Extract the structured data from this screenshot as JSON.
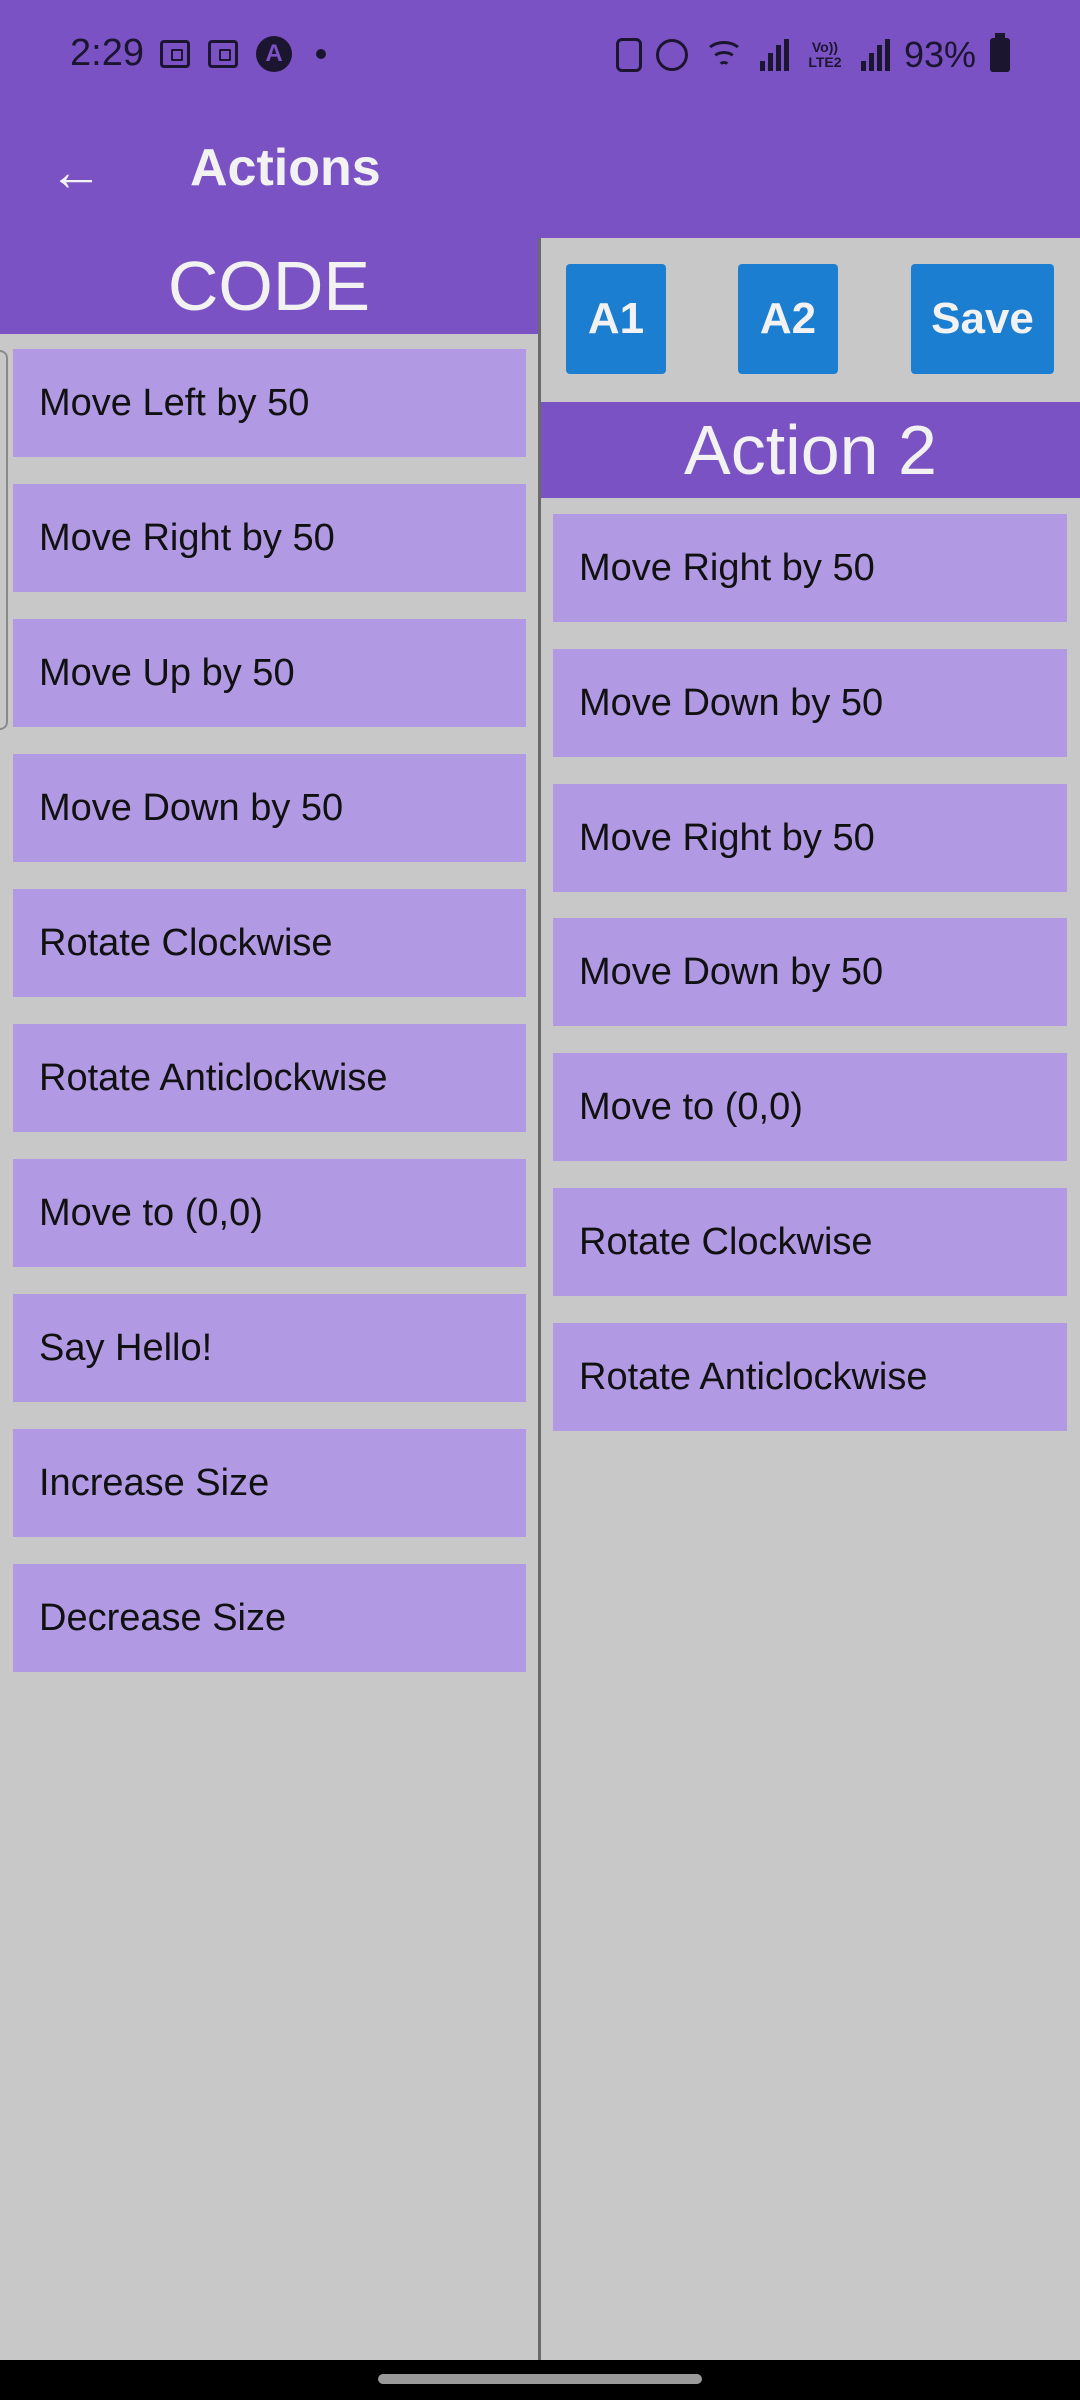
{
  "status_bar": {
    "time": "2:29",
    "battery": "93%",
    "volte_label": "Vo)) LTE2",
    "launcher_icon": "A"
  },
  "app_bar": {
    "title": "Actions",
    "back_icon": "←"
  },
  "left_panel": {
    "header": "CODE",
    "items": [
      {
        "label": "Move Left by 50"
      },
      {
        "label": "Move Right by 50"
      },
      {
        "label": "Move Up by 50"
      },
      {
        "label": "Move Down by 50"
      },
      {
        "label": "Rotate Clockwise"
      },
      {
        "label": "Rotate Anticlockwise"
      },
      {
        "label": "Move to (0,0)"
      },
      {
        "label": "Say Hello!"
      },
      {
        "label": "Increase Size"
      },
      {
        "label": "Decrease Size"
      }
    ]
  },
  "right_panel": {
    "buttons": {
      "a1": "A1",
      "a2": "A2",
      "save": "Save"
    },
    "header": "Action 2",
    "items": [
      {
        "label": "Move Right by 50"
      },
      {
        "label": "Move Down by 50"
      },
      {
        "label": "Move Right by 50"
      },
      {
        "label": "Move Down by 50"
      },
      {
        "label": "Move to (0,0)"
      },
      {
        "label": "Rotate Clockwise"
      },
      {
        "label": "Rotate Anticlockwise"
      }
    ]
  },
  "colors": {
    "primary": "#7b52c4",
    "item_bg": "#b299e4",
    "button_bg": "#1b7ed1",
    "background": "#c8c8c8"
  }
}
